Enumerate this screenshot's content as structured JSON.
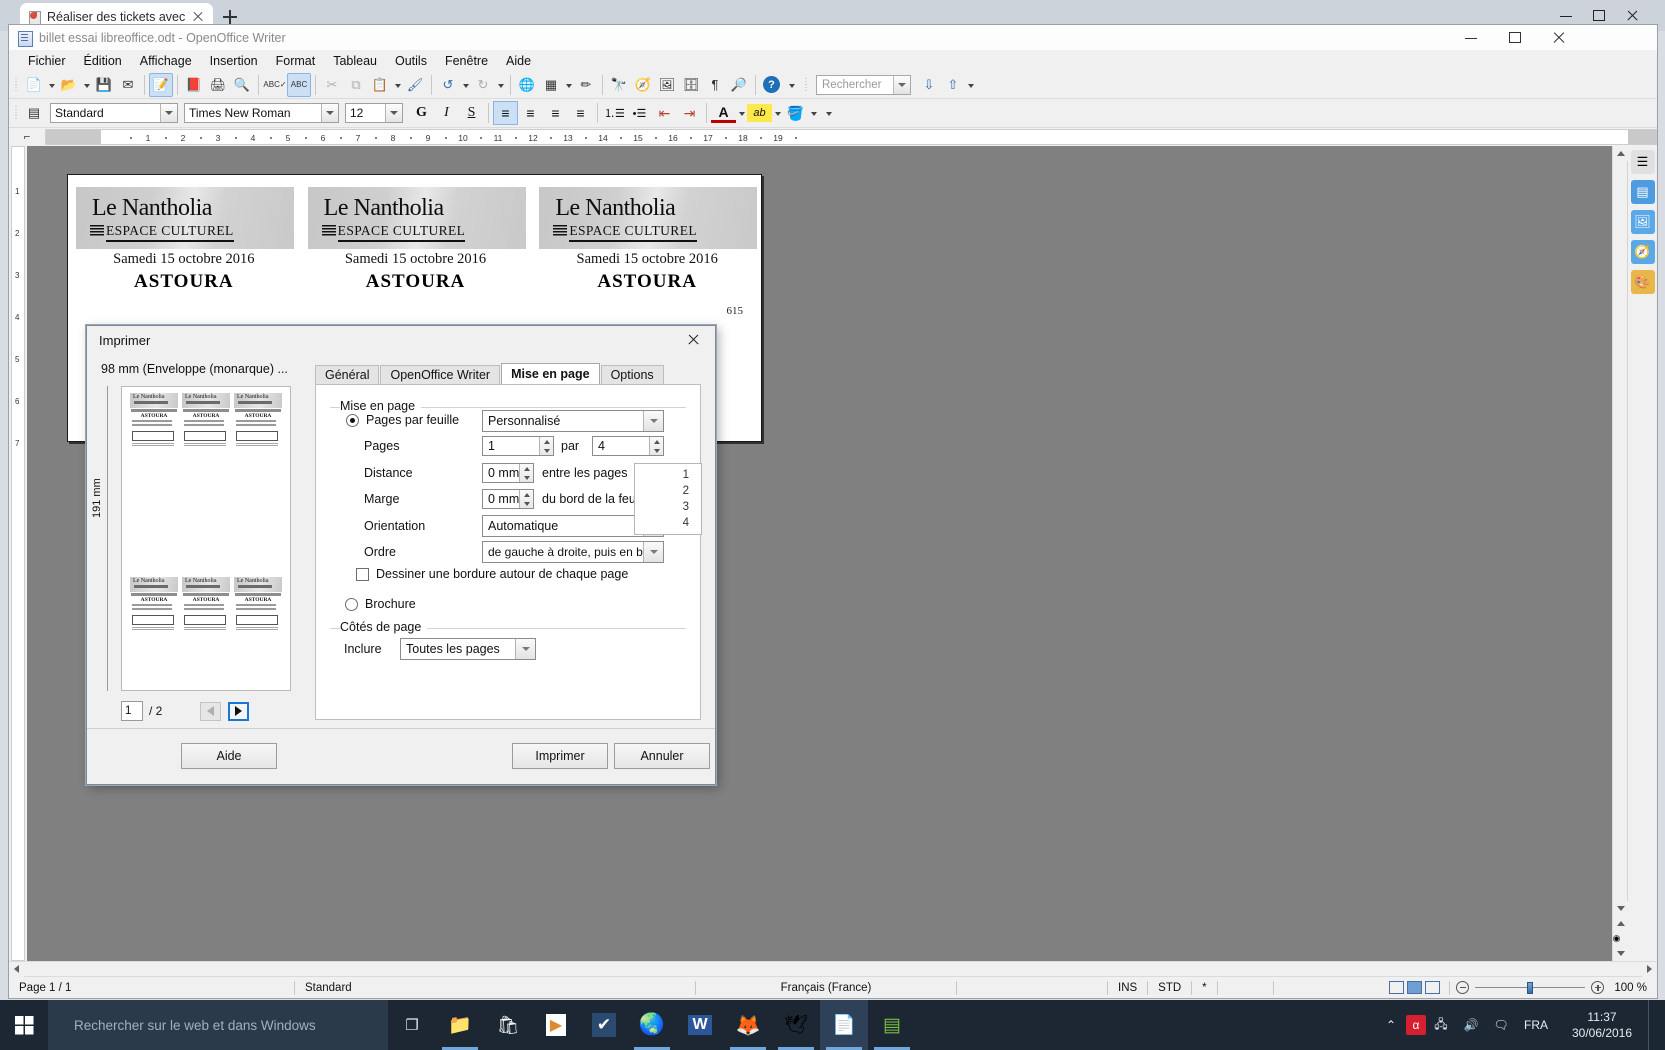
{
  "browser": {
    "tab_title": "Réaliser des tickets avec T...",
    "new_tab_label": "+",
    "minimize": "—",
    "maximize": "▢",
    "close": "✕"
  },
  "app": {
    "title": "billet essai libreoffice.odt - OpenOffice Writer",
    "menus": [
      {
        "label": "Fichier"
      },
      {
        "label": "Édition"
      },
      {
        "label": "Affichage"
      },
      {
        "label": "Insertion"
      },
      {
        "label": "Format"
      },
      {
        "label": "Tableau"
      },
      {
        "label": "Outils"
      },
      {
        "label": "Fenêtre"
      },
      {
        "label": "Aide"
      }
    ]
  },
  "toolbar_standard": {
    "items": [
      {
        "name": "new-document-icon",
        "glyph": "📄"
      },
      {
        "name": "open-document-icon",
        "glyph": "📂"
      },
      {
        "name": "save-icon",
        "glyph": "💾"
      },
      {
        "name": "send-email-icon",
        "glyph": "✉"
      },
      {
        "name": "edit-file-icon",
        "glyph": "📝"
      },
      {
        "name": "export-pdf-icon",
        "glyph": "📕"
      },
      {
        "name": "print-icon",
        "glyph": "🖨"
      },
      {
        "name": "print-preview-icon",
        "glyph": "🔍"
      },
      {
        "name": "spelling-icon",
        "glyph": "ABC"
      },
      {
        "name": "autospellcheck-icon",
        "glyph": "ABC"
      },
      {
        "name": "cut-icon",
        "glyph": "✂"
      },
      {
        "name": "copy-icon",
        "glyph": "⧉"
      },
      {
        "name": "paste-icon",
        "glyph": "📋"
      },
      {
        "name": "clone-formatting-icon",
        "glyph": "🖌"
      },
      {
        "name": "undo-icon",
        "glyph": "↺"
      },
      {
        "name": "redo-icon",
        "glyph": "↻"
      },
      {
        "name": "insert-chart-icon",
        "glyph": "🌐"
      },
      {
        "name": "insert-table-icon",
        "glyph": "▦"
      },
      {
        "name": "draw-functions-icon",
        "glyph": "✏"
      },
      {
        "name": "find-replace-icon",
        "glyph": "🔭"
      },
      {
        "name": "navigator-icon",
        "glyph": "🧭"
      },
      {
        "name": "gallery-icon",
        "glyph": "🖼"
      },
      {
        "name": "data-sources-icon",
        "glyph": "🗄"
      },
      {
        "name": "formatting-marks-icon",
        "glyph": "¶"
      },
      {
        "name": "zoom-icon",
        "glyph": "🔎"
      },
      {
        "name": "help-icon",
        "glyph": "?"
      }
    ],
    "search_placeholder": "Rechercher",
    "find_down_icon": "⇩",
    "find_up_icon": "⇧"
  },
  "toolbar_format": {
    "paragraph_style": "Standard",
    "font_name": "Times New Roman",
    "font_size": "12",
    "bold": "G",
    "italic": "I",
    "underline": "S",
    "align_left_icon": "align-left-icon",
    "align_center_icon": "align-center-icon",
    "align_right_icon": "align-right-icon",
    "align_justify_icon": "align-justify-icon",
    "numbered_list_icon": "ordered-list-icon",
    "bullet_list_icon": "bullet-list-icon",
    "decrease_indent_icon": "decrease-indent-icon",
    "increase_indent_icon": "increase-indent-icon",
    "font_color": "A",
    "highlight_color": "ab",
    "background_color": "background-color-icon"
  },
  "ruler": {
    "h_marks": [
      "1",
      "2",
      "3",
      "4",
      "5",
      "6",
      "7",
      "8",
      "9",
      "10",
      "11",
      "12",
      "13",
      "14",
      "15",
      "16",
      "17",
      "18",
      "19"
    ],
    "v_marks": [
      "1",
      "2",
      "3",
      "4",
      "5",
      "6",
      "7"
    ]
  },
  "document": {
    "tickets": [
      {
        "logo_line1": "Le Nantholia",
        "logo_line2": "ESPACE CULTUREL",
        "date": "Samedi 15 octobre 2016",
        "title": "ASTOURA"
      },
      {
        "logo_line1": "Le Nantholia",
        "logo_line2": "ESPACE CULTUREL",
        "date": "Samedi 15 octobre 2016",
        "title": "ASTOURA"
      },
      {
        "logo_line1": "Le Nantholia",
        "logo_line2": "ESPACE CULTUREL",
        "date": "Samedi 15 octobre 2016",
        "title": "ASTOURA"
      }
    ],
    "side_text": "615"
  },
  "print_dialog": {
    "title": "Imprimer",
    "close_icon": "close-icon",
    "preview": {
      "paper_size": "98 mm (Enveloppe (monarque) ...",
      "height_label": "191 mm",
      "page_input": "1",
      "total_pages": "/ 2",
      "prev_icon": "previous-page-icon",
      "next_icon": "next-page-icon",
      "ticket_name": "ASTOURA"
    },
    "tabs": [
      {
        "label": "Général",
        "selected": false
      },
      {
        "label": "OpenOffice Writer",
        "selected": false
      },
      {
        "label": "Mise en page",
        "selected": true
      },
      {
        "label": "Options",
        "selected": false
      }
    ],
    "layout_group": {
      "title": "Mise en page",
      "pages_per_sheet_label": "Pages par feuille",
      "pages_per_sheet_value": "Personnalisé",
      "pages_per_sheet_selected": true,
      "pages_label": "Pages",
      "pages_value": "1",
      "by_label": "par",
      "by_value": "4",
      "distance_label": "Distance",
      "distance_value": "0 mm",
      "distance_suffix": "entre les pages",
      "margin_label": "Marge",
      "margin_value": "0 mm",
      "margin_suffix": "du bord de la feuille",
      "orientation_label": "Orientation",
      "orientation_value": "Automatique",
      "order_label": "Ordre",
      "order_value": "de gauche à droite, puis en bas",
      "border_checkbox_label": "Dessiner une bordure autour de chaque page",
      "border_checked": false,
      "brochure_label": "Brochure",
      "brochure_selected": false,
      "order_preview_numbers": [
        "1",
        "2",
        "3",
        "4"
      ]
    },
    "page_sides_group": {
      "title": "Côtés de page",
      "include_label": "Inclure",
      "include_value": "Toutes les pages"
    },
    "buttons": {
      "help": "Aide",
      "print": "Imprimer",
      "cancel": "Annuler"
    }
  },
  "statusbar": {
    "page": "Page 1 / 1",
    "style": "Standard",
    "language": "Français (France)",
    "insert_mode": "INS",
    "selection_mode": "STD",
    "modified": "*",
    "zoom_value": "100 %",
    "view_single_icon": "single-page-view-icon",
    "view_multi_icon": "multi-page-view-icon",
    "view_book_icon": "book-view-icon"
  },
  "taskbar": {
    "start_icon": "windows-start-icon",
    "search_placeholder": "Rechercher sur le web et dans Windows",
    "taskview_icon": "task-view-icon",
    "apps": [
      {
        "name": "file-explorer-icon",
        "glyph": "📁",
        "active": false,
        "running": true
      },
      {
        "name": "microsoft-store-icon",
        "glyph": "🛍",
        "active": false,
        "running": false
      },
      {
        "name": "media-player-icon",
        "glyph": "▶",
        "active": false,
        "running": false
      },
      {
        "name": "todo-check-icon",
        "glyph": "✔",
        "active": false,
        "running": false
      },
      {
        "name": "google-chrome-icon",
        "glyph": "◉",
        "active": false,
        "running": true
      },
      {
        "name": "microsoft-word-icon",
        "glyph": "W",
        "active": false,
        "running": false
      },
      {
        "name": "firefox-icon",
        "glyph": "🦊",
        "active": false,
        "running": true
      },
      {
        "name": "thunderbird-icon",
        "glyph": "🕊",
        "active": false,
        "running": true
      },
      {
        "name": "openoffice-writer-icon",
        "glyph": "📄",
        "active": true,
        "running": true
      },
      {
        "name": "libreoffice-icon",
        "glyph": "▤",
        "active": false,
        "running": true
      }
    ],
    "tray": {
      "chevron_icon": "show-hidden-icons",
      "antivirus_icon": "avira-icon",
      "network_icon": "network-icon",
      "volume_icon": "volume-icon",
      "action-center_icon": "action-center-icon",
      "language": "FRA",
      "time": "11:37",
      "date": "30/06/2016"
    }
  },
  "colors": {
    "accent_blue": "#1877d2",
    "taskbar_bg": "#1c2733",
    "toolbar_bg": "#f0f0f0",
    "canvas_bg": "#808080"
  }
}
